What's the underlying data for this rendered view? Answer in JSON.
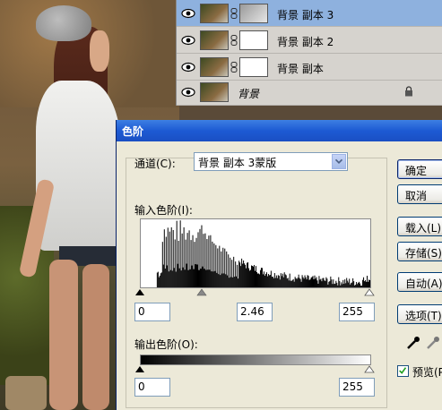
{
  "layers": [
    {
      "name": "背景 副本 3",
      "selected": true,
      "mask": "dark"
    },
    {
      "name": "背景 副本 2",
      "selected": false,
      "mask": "white"
    },
    {
      "name": "背景 副本",
      "selected": false,
      "mask": "white"
    },
    {
      "name": "背景",
      "selected": false,
      "background": true
    }
  ],
  "dialog": {
    "title": "色阶",
    "channel_label": "通道(C):",
    "channel_value": "背景 副本 3蒙版",
    "input_levels_label": "输入色阶(I):",
    "input_black": "0",
    "input_gamma": "2.46",
    "input_white": "255",
    "output_levels_label": "输出色阶(O):",
    "output_black": "0",
    "output_white": "255",
    "buttons": {
      "ok": "确定",
      "cancel": "取消",
      "load": "载入(L)",
      "save": "存储(S)",
      "auto": "自动(A)",
      "options": "选项(T)"
    },
    "preview_label": "预览(P)",
    "preview_checked": true
  },
  "colors": {
    "titlebar": "#1d5ad3",
    "selected_layer": "#8eb1de",
    "dialog_bg": "#ece9d8"
  }
}
